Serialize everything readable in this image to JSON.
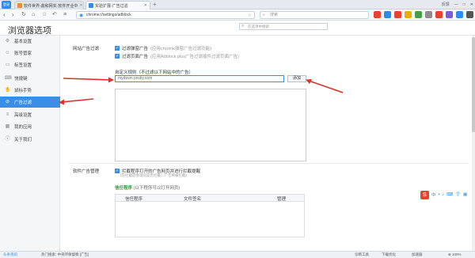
{
  "tabs": {
    "logo": "登录",
    "items": [
      {
        "label": "软件世界-鼎和网实·软件开业中",
        "color": "#f08c2e"
      },
      {
        "label": "实验扩展-广告过滤",
        "color": "#2d8cf0"
      }
    ],
    "new_tab": "+",
    "window_controls": [
      "反馈",
      "—",
      "□",
      "✕"
    ]
  },
  "toolbar": {
    "address": "chrome://settings/adblock",
    "search_placeholder": "搜索"
  },
  "page": {
    "title": "浏览器选项",
    "search_placeholder": "在选项中搜索"
  },
  "sidebar": {
    "items": [
      {
        "label": "基本设置",
        "icon": "gear-icon",
        "glyph": "⚙"
      },
      {
        "label": "账号管家",
        "icon": "user-icon",
        "glyph": "☺"
      },
      {
        "label": "标签设置",
        "icon": "tab-icon",
        "glyph": "▭"
      },
      {
        "label": "快捷键",
        "icon": "keyboard-icon",
        "glyph": "⌨"
      },
      {
        "label": "鼠标手势",
        "icon": "mouse-icon",
        "glyph": "✋"
      },
      {
        "label": "广告过滤",
        "icon": "block-icon",
        "glyph": "⊘",
        "active": true
      },
      {
        "label": "高级设置",
        "icon": "advanced-icon",
        "glyph": "≡"
      },
      {
        "label": "我的应用",
        "icon": "apps-icon",
        "glyph": "▦"
      },
      {
        "label": "关于我们",
        "icon": "info-icon",
        "glyph": "ⓘ"
      }
    ]
  },
  "adblock": {
    "section_label": "网站广告过滤",
    "option1": "过滤弹窗广告",
    "option1_hint": "(应用chrome弹窗广告过滤功能)",
    "option2": "过滤页面广告",
    "option2_hint": "(应用Adblock plus广告过滤插件过滤页面广告)",
    "rule_label": "自定义规则（不过滤以下网站中的广告）",
    "rule_value": "mydown.yesky.com",
    "add_button": "添加"
  },
  "program": {
    "section_label": "软件广告管理",
    "option": "拦截程序打开的广告网页并进行拦截提醒",
    "option_sub": "(在拦截后会询问是否拦截，广告将被拦截)",
    "whitelist_title": "信任程序",
    "whitelist_hint": "(以下程序可以打开网页)",
    "columns": [
      "信任程序",
      "文件签名",
      "管理"
    ]
  },
  "ime": {
    "logo": "S",
    "items": [
      "中",
      "•",
      "♪",
      "⌨",
      "👕",
      "▦"
    ]
  },
  "statusbar": {
    "left": "头条资讯",
    "news": "热门搜索: 中央环保督察 [广告]",
    "right": [
      "诊断工具",
      "下载优化",
      "加速器",
      "⊕ 100%"
    ]
  },
  "colors": {
    "accent": "#3a8ee6",
    "arrow": "#e0302a"
  }
}
